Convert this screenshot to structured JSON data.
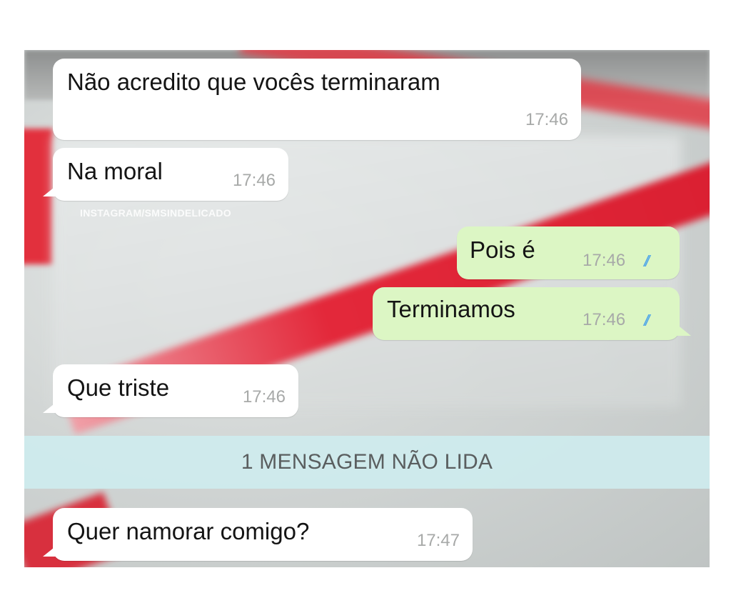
{
  "watermark": "INSTAGRAM/SMSINDELICADO",
  "messages": [
    {
      "direction": "in",
      "text": "Não acredito que vocês terminaram",
      "time": "17:46"
    },
    {
      "direction": "in",
      "text": "Na moral",
      "time": "17:46"
    },
    {
      "direction": "out",
      "text": "Pois é",
      "time": "17:46",
      "status": "read"
    },
    {
      "direction": "out",
      "text": "Terminamos",
      "time": "17:46",
      "status": "read"
    },
    {
      "direction": "in",
      "text": "Que triste",
      "time": "17:46"
    },
    {
      "direction": "in",
      "text": "Quer namorar comigo?",
      "time": "17:47"
    }
  ],
  "unread_banner": "1 MENSAGEM NÃO LIDA",
  "colors": {
    "incoming_bubble": "#ffffff",
    "outgoing_bubble": "#dcf6c4",
    "read_ticks": "#4fa6e8",
    "unread_banner": "#ceecee"
  },
  "icons": {
    "read_status": "double-check-icon"
  }
}
